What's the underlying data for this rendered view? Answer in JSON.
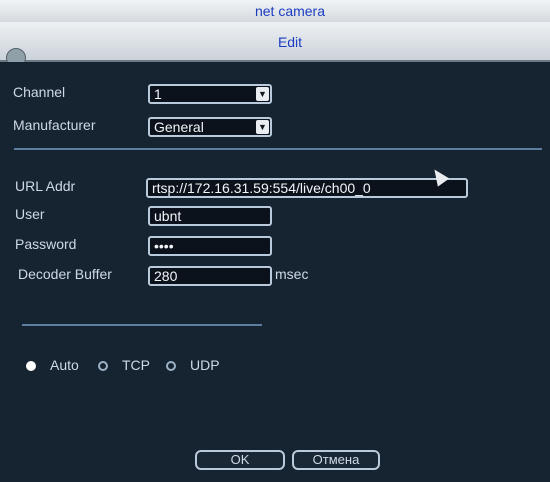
{
  "window": {
    "title": "net camera"
  },
  "dialog": {
    "title": "Edit"
  },
  "form": {
    "channel": {
      "label": "Channel",
      "value": "1"
    },
    "manufacturer": {
      "label": "Manufacturer",
      "value": "General"
    },
    "url": {
      "label": "URL Addr",
      "value": "rtsp://172.16.31.59:554/live/ch00_0"
    },
    "user": {
      "label": "User",
      "value": "ubnt"
    },
    "password": {
      "label": "Password",
      "value": "••••"
    },
    "decoder_buffer": {
      "label": "Decoder Buffer",
      "value": "280",
      "unit": "msec"
    }
  },
  "protocol": {
    "selected": "Auto",
    "options": [
      "Auto",
      "TCP",
      "UDP"
    ]
  },
  "buttons": {
    "ok": "OK",
    "cancel": "Отмена"
  },
  "icons": {
    "dropdown": "chevron-down-icon",
    "pointer": "mouse-cursor-icon"
  }
}
